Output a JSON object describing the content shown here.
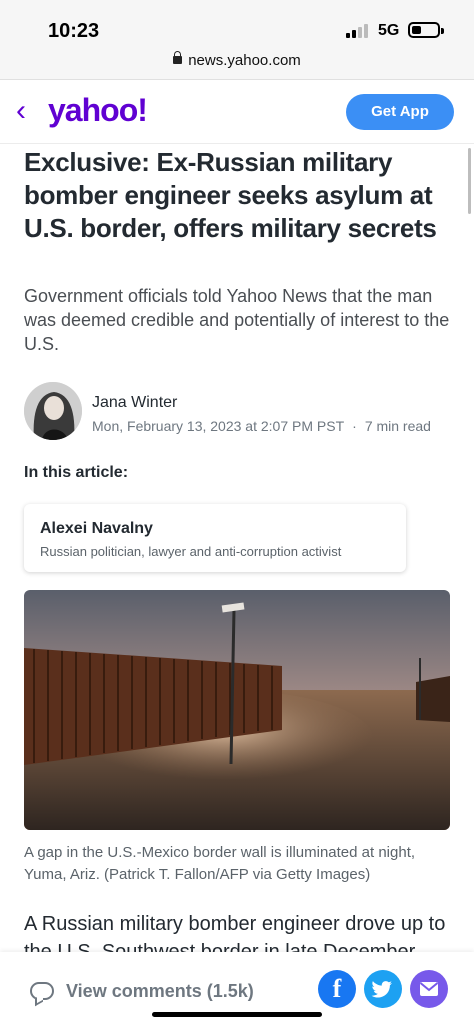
{
  "status_bar": {
    "time": "10:23",
    "network": "5G"
  },
  "browser": {
    "url": "news.yahoo.com"
  },
  "site_header": {
    "logo": "yahoo!",
    "get_app": "Get App",
    "back_icon": "chevron-left-icon"
  },
  "article": {
    "headline": "Exclusive: Ex-Russian military bomber engineer seeks asylum at U.S. border, offers military secrets",
    "subhead": "Government officials told Yahoo News that the man was deemed credible and potentially of interest to the U.S.",
    "author": {
      "name": "Jana Winter",
      "date": "Mon, February 13, 2023 at 2:07 PM PST",
      "separator": "·",
      "read_time": "7 min read"
    },
    "in_this_article": "In this article:",
    "entity_card": {
      "title": "Alexei Navalny",
      "description": "Russian politician, lawyer and anti-corruption activist"
    },
    "photo_caption": "A gap in the U.S.-Mexico border wall is illuminated at night, Yuma, Ariz. (Patrick T. Fallon/AFP via Getty Images)",
    "body_first_line": "A Russian military bomber engineer drove up to the U.S. Southwest border in late December"
  },
  "bottom_bar": {
    "comments_label": "View comments (1.5k)",
    "share_icons": [
      "facebook-icon",
      "twitter-icon",
      "mail-icon"
    ]
  },
  "colors": {
    "brand": "#6001d2",
    "get_app": "#3b8ff5",
    "facebook": "#1877f2",
    "twitter": "#1da1f2",
    "mail": "#7759ea"
  }
}
